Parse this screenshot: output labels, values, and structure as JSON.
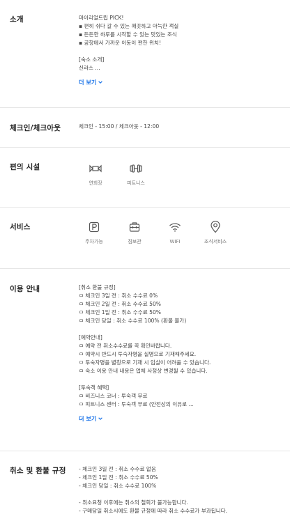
{
  "intro": {
    "title": "소개",
    "lines": [
      "마이리얼트립 PICK!",
      "▪ 편히 쉬다 갈 수 있는 깨끗하고 아늑한 객실",
      "▪ 든든한 하루를 시작할 수 있는 맛있는 조식",
      "▪ 공항에서 가까운 이동이 편한 위치!",
      "",
      "[숙소 소개]",
      "신라스 ..."
    ],
    "more_label": "더 보기"
  },
  "checkin": {
    "title": "체크인/체크아웃",
    "value": "체크인 - 15:00 / 체크아웃 - 12:00"
  },
  "facilities": {
    "title": "편의 시설",
    "items": [
      {
        "label": "연회장",
        "icon": "banquet-icon"
      },
      {
        "label": "피트니스",
        "icon": "dumbbell-icon"
      }
    ]
  },
  "services": {
    "title": "서비스",
    "items": [
      {
        "label": "주차가능",
        "icon": "parking-icon"
      },
      {
        "label": "짐보관",
        "icon": "luggage-icon"
      },
      {
        "label": "WIFI",
        "icon": "wifi-icon"
      },
      {
        "label": "조식서비스",
        "icon": "breakfast-icon"
      }
    ]
  },
  "usage": {
    "title": "이용 안내",
    "lines": [
      "[취소 환불 규정]",
      "ㅁ 체크인 3일 전 : 취소 수수료 0%",
      "ㅁ 체크인 2일 전 : 취소 수수료 50%",
      "ㅁ 체크인 1일 전 : 취소 수수료 50%",
      "ㅁ 체크인 당일 : 취소 수수료 100% (환불 불가)",
      "",
      "[예약안내]",
      "ㅁ 예약 전 취소수수료를 꼭 확인바랍니다.",
      "ㅁ 예약시 반드시 투숙자명을 실명으로 기재해주세요.",
      "ㅁ 투숙자명을 별칭으로 기재 시 입실이 어려울 수 있습니다.",
      "ㅁ 숙소 이용 안내 내용은 업체 사정상 변경될 수 있습니다.",
      "",
      "[투숙객 혜택]",
      "ㅁ 비즈니스 코너 : 투숙객 무료",
      "ㅁ 피트니스 센터 : 투숙객 무료 (안전상의 이유로 ..."
    ],
    "more_label": "더 보기"
  },
  "refund": {
    "title": "취소 및 환불 규정",
    "lines": [
      "- 체크인 3일 전 : 취소 수수료 없음",
      "- 체크인 1일 전 : 취소 수수료 50%",
      "- 체크인 당일 : 취소 수수료 100%",
      "",
      "- 취소요청 이후에는 취소의 철회가 불가능합니다.",
      "- 구매당일 취소시에도 환불 규정에 따라 취소 수수료가 부과됩니다."
    ]
  },
  "colors": {
    "accent": "#1a73e8",
    "divider": "#e6e6e6",
    "icon": "#555555"
  }
}
